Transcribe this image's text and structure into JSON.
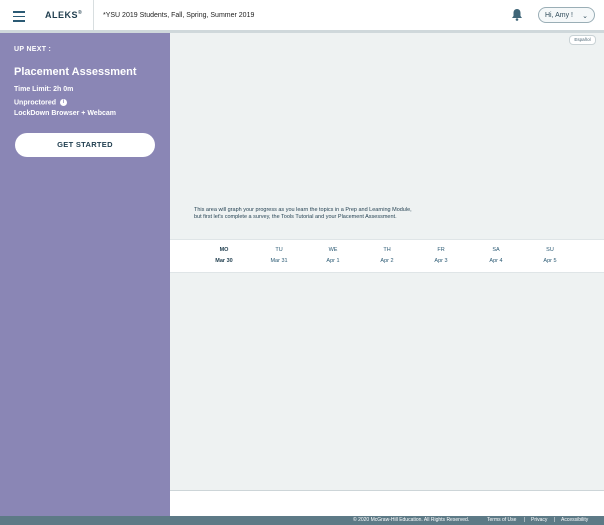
{
  "header": {
    "logo": "ALEKS",
    "logo_mark": "®",
    "class_name": "*YSU 2019 Students, Fall, Spring, Summer 2019",
    "greeting": "Hi, Amy !"
  },
  "language_toggle": "Español",
  "sidebar": {
    "up_next": "UP NEXT :",
    "title": "Placement Assessment",
    "time_limit": "Time Limit: 2h 0m",
    "proctor": "Unproctored",
    "info_glyph": "i",
    "browser": "LockDown Browser + Webcam",
    "button": "GET STARTED"
  },
  "main": {
    "graph_message": "This area will graph your progress as you learn the topics in a Prep and Learning Module, but first let's complete a survey, the Tools Tutorial and your Placement Assessment."
  },
  "week": [
    {
      "day": "MO",
      "date": "Mar 30"
    },
    {
      "day": "TU",
      "date": "Mar 31"
    },
    {
      "day": "WE",
      "date": "Apr 1"
    },
    {
      "day": "TH",
      "date": "Apr 2"
    },
    {
      "day": "FR",
      "date": "Apr 3"
    },
    {
      "day": "SA",
      "date": "Apr 4"
    },
    {
      "day": "SU",
      "date": "Apr 5"
    }
  ],
  "footer": {
    "copyright": "© 2020 McGraw-Hill Education. All Rights Reserved.",
    "terms": "Terms of Use",
    "privacy": "Privacy",
    "accessibility": "Accessibility",
    "separator": "|"
  },
  "icons": {
    "menu": "menu-icon",
    "bell": "bell-icon",
    "chevron": "chevron-down-icon",
    "info": "info-icon"
  },
  "colors": {
    "sidebar": "#8a86b5",
    "accent": "#1f3d4e",
    "footer": "#5d7a86"
  }
}
